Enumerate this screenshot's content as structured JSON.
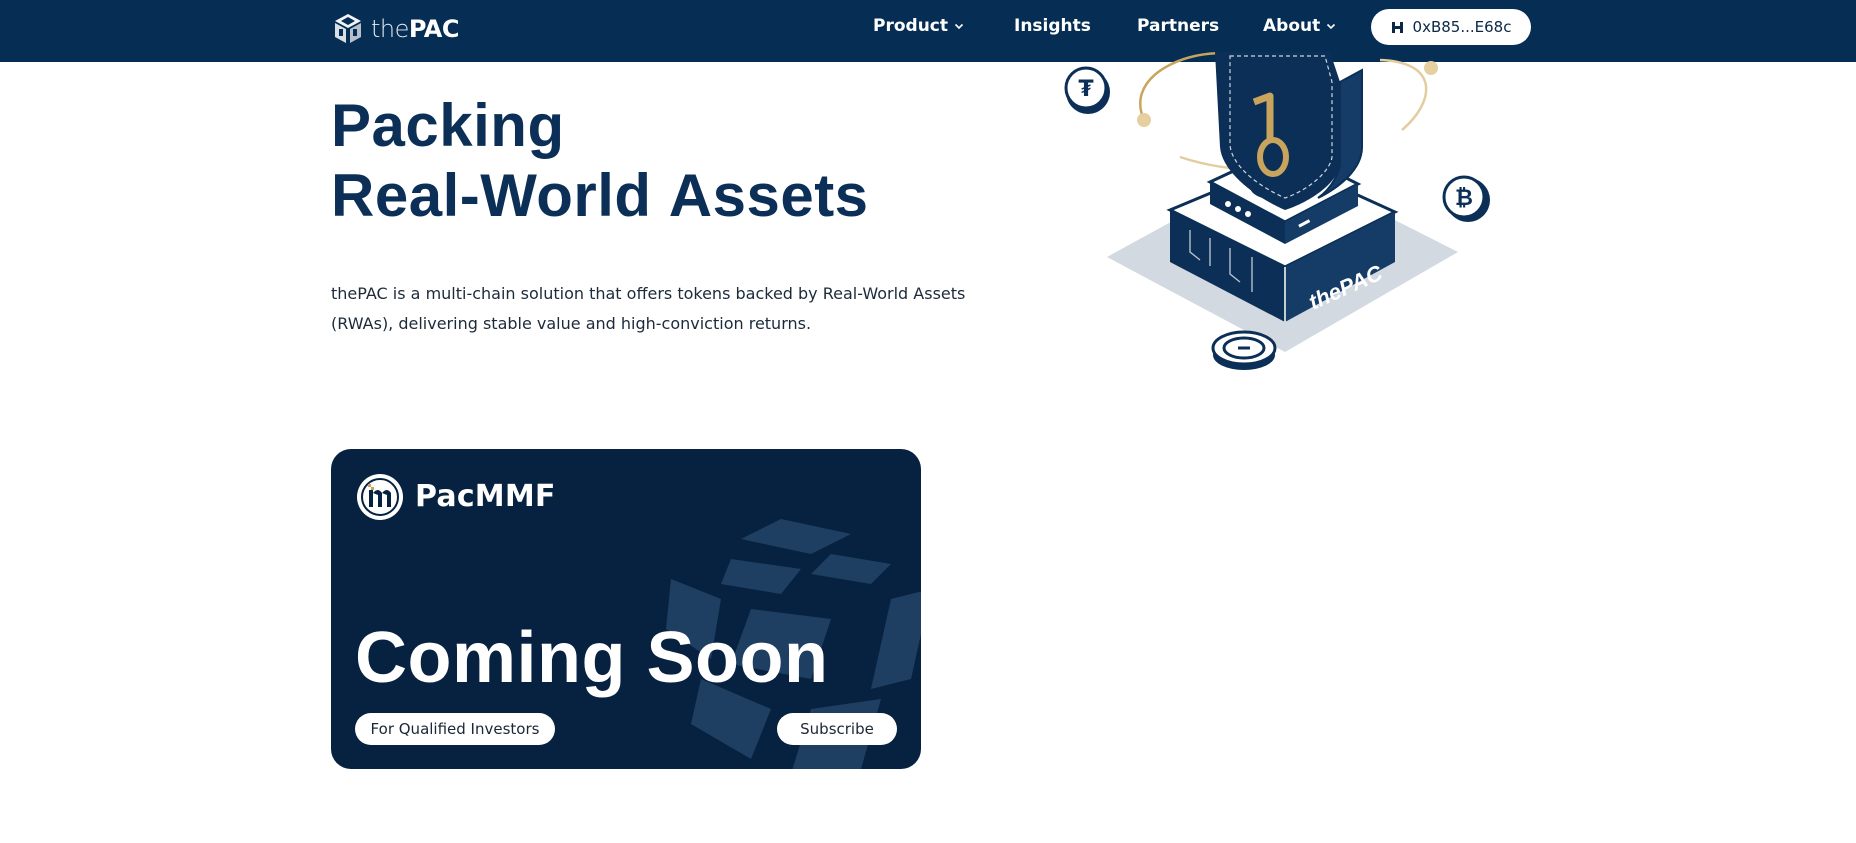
{
  "brand": {
    "prefix": "the",
    "name": "PAC"
  },
  "nav": {
    "items": [
      {
        "label": "Product",
        "has_dropdown": true
      },
      {
        "label": "Insights",
        "has_dropdown": false
      },
      {
        "label": "Partners",
        "has_dropdown": false
      },
      {
        "label": "About",
        "has_dropdown": true
      }
    ],
    "wallet": {
      "address": "0xB85...E68c",
      "icon": "hyperliquid-icon"
    }
  },
  "hero": {
    "title_line1": "Packing",
    "title_line2_prefix": "Real-World ",
    "title_highlight": "Assets",
    "description": "thePAC is a multi-chain solution that offers tokens backed by Real-World Assets (RWAs), delivering stable value and high-conviction returns.",
    "illustration_label": "thePAC"
  },
  "card": {
    "name": "PacMMF",
    "status": "Coming Soon",
    "badge": "For Qualified Investors",
    "cta": "Subscribe"
  },
  "colors": {
    "nav_bg": "#062e55",
    "title": "#0b2f56",
    "accent_gold": "#c9a45c",
    "card_bg": "#062240"
  }
}
